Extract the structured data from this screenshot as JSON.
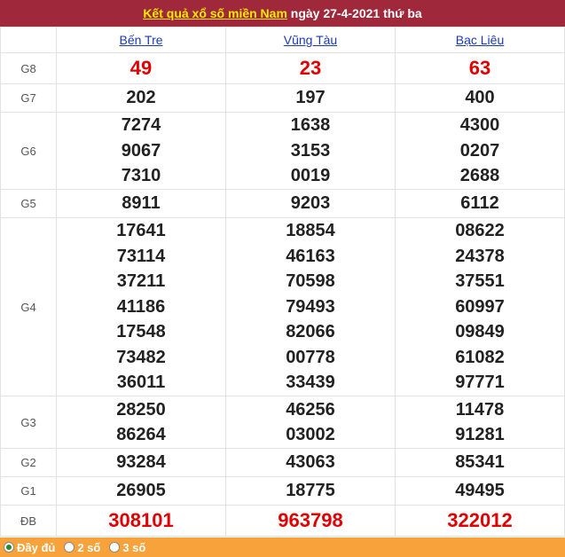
{
  "header": {
    "link_text": "Kết quả xổ số miền Nam",
    "date_text": " ngày 27-4-2021 thứ ba"
  },
  "columns": [
    "Bến Tre",
    "Vũng Tàu",
    "Bạc Liêu"
  ],
  "rows": [
    {
      "label": "G8",
      "values": [
        [
          "49"
        ],
        [
          "23"
        ],
        [
          "63"
        ]
      ]
    },
    {
      "label": "G7",
      "values": [
        [
          "202"
        ],
        [
          "197"
        ],
        [
          "400"
        ]
      ]
    },
    {
      "label": "G6",
      "values": [
        [
          "7274",
          "9067",
          "7310"
        ],
        [
          "1638",
          "3153",
          "0019"
        ],
        [
          "4300",
          "0207",
          "2688"
        ]
      ]
    },
    {
      "label": "G5",
      "values": [
        [
          "8911"
        ],
        [
          "9203"
        ],
        [
          "6112"
        ]
      ]
    },
    {
      "label": "G4",
      "values": [
        [
          "17641",
          "73114",
          "37211",
          "41186",
          "17548",
          "73482",
          "36011"
        ],
        [
          "18854",
          "46163",
          "70598",
          "79493",
          "82066",
          "00778",
          "33439"
        ],
        [
          "08622",
          "24378",
          "37551",
          "60997",
          "09849",
          "61082",
          "97771"
        ]
      ]
    },
    {
      "label": "G3",
      "values": [
        [
          "28250",
          "86264"
        ],
        [
          "46256",
          "03002"
        ],
        [
          "11478",
          "91281"
        ]
      ]
    },
    {
      "label": "G2",
      "values": [
        [
          "93284"
        ],
        [
          "43063"
        ],
        [
          "85341"
        ]
      ]
    },
    {
      "label": "G1",
      "values": [
        [
          "26905"
        ],
        [
          "18775"
        ],
        [
          "49495"
        ]
      ]
    },
    {
      "label": "ĐB",
      "values": [
        [
          "308101"
        ],
        [
          "963798"
        ],
        [
          "322012"
        ]
      ]
    }
  ],
  "footer": {
    "options": [
      "Đầy đủ",
      "2 số",
      "3 số"
    ],
    "selected": "Đầy đủ"
  },
  "colors": {
    "header_bg": "#a0283b",
    "link_yellow": "#ffea00",
    "prize_red": "#e00000",
    "footer_bg": "#f7a23a"
  }
}
